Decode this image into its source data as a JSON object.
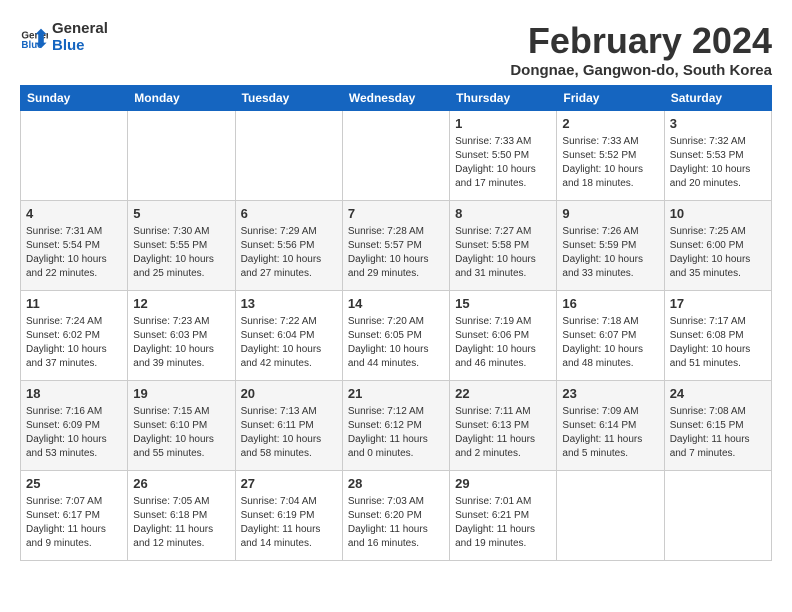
{
  "logo": {
    "line1": "General",
    "line2": "Blue"
  },
  "title": "February 2024",
  "location": "Dongnae, Gangwon-do, South Korea",
  "days_of_week": [
    "Sunday",
    "Monday",
    "Tuesday",
    "Wednesday",
    "Thursday",
    "Friday",
    "Saturday"
  ],
  "weeks": [
    [
      {
        "day": "",
        "content": ""
      },
      {
        "day": "",
        "content": ""
      },
      {
        "day": "",
        "content": ""
      },
      {
        "day": "",
        "content": ""
      },
      {
        "day": "1",
        "content": "Sunrise: 7:33 AM\nSunset: 5:50 PM\nDaylight: 10 hours and 17 minutes."
      },
      {
        "day": "2",
        "content": "Sunrise: 7:33 AM\nSunset: 5:52 PM\nDaylight: 10 hours and 18 minutes."
      },
      {
        "day": "3",
        "content": "Sunrise: 7:32 AM\nSunset: 5:53 PM\nDaylight: 10 hours and 20 minutes."
      }
    ],
    [
      {
        "day": "4",
        "content": "Sunrise: 7:31 AM\nSunset: 5:54 PM\nDaylight: 10 hours and 22 minutes."
      },
      {
        "day": "5",
        "content": "Sunrise: 7:30 AM\nSunset: 5:55 PM\nDaylight: 10 hours and 25 minutes."
      },
      {
        "day": "6",
        "content": "Sunrise: 7:29 AM\nSunset: 5:56 PM\nDaylight: 10 hours and 27 minutes."
      },
      {
        "day": "7",
        "content": "Sunrise: 7:28 AM\nSunset: 5:57 PM\nDaylight: 10 hours and 29 minutes."
      },
      {
        "day": "8",
        "content": "Sunrise: 7:27 AM\nSunset: 5:58 PM\nDaylight: 10 hours and 31 minutes."
      },
      {
        "day": "9",
        "content": "Sunrise: 7:26 AM\nSunset: 5:59 PM\nDaylight: 10 hours and 33 minutes."
      },
      {
        "day": "10",
        "content": "Sunrise: 7:25 AM\nSunset: 6:00 PM\nDaylight: 10 hours and 35 minutes."
      }
    ],
    [
      {
        "day": "11",
        "content": "Sunrise: 7:24 AM\nSunset: 6:02 PM\nDaylight: 10 hours and 37 minutes."
      },
      {
        "day": "12",
        "content": "Sunrise: 7:23 AM\nSunset: 6:03 PM\nDaylight: 10 hours and 39 minutes."
      },
      {
        "day": "13",
        "content": "Sunrise: 7:22 AM\nSunset: 6:04 PM\nDaylight: 10 hours and 42 minutes."
      },
      {
        "day": "14",
        "content": "Sunrise: 7:20 AM\nSunset: 6:05 PM\nDaylight: 10 hours and 44 minutes."
      },
      {
        "day": "15",
        "content": "Sunrise: 7:19 AM\nSunset: 6:06 PM\nDaylight: 10 hours and 46 minutes."
      },
      {
        "day": "16",
        "content": "Sunrise: 7:18 AM\nSunset: 6:07 PM\nDaylight: 10 hours and 48 minutes."
      },
      {
        "day": "17",
        "content": "Sunrise: 7:17 AM\nSunset: 6:08 PM\nDaylight: 10 hours and 51 minutes."
      }
    ],
    [
      {
        "day": "18",
        "content": "Sunrise: 7:16 AM\nSunset: 6:09 PM\nDaylight: 10 hours and 53 minutes."
      },
      {
        "day": "19",
        "content": "Sunrise: 7:15 AM\nSunset: 6:10 PM\nDaylight: 10 hours and 55 minutes."
      },
      {
        "day": "20",
        "content": "Sunrise: 7:13 AM\nSunset: 6:11 PM\nDaylight: 10 hours and 58 minutes."
      },
      {
        "day": "21",
        "content": "Sunrise: 7:12 AM\nSunset: 6:12 PM\nDaylight: 11 hours and 0 minutes."
      },
      {
        "day": "22",
        "content": "Sunrise: 7:11 AM\nSunset: 6:13 PM\nDaylight: 11 hours and 2 minutes."
      },
      {
        "day": "23",
        "content": "Sunrise: 7:09 AM\nSunset: 6:14 PM\nDaylight: 11 hours and 5 minutes."
      },
      {
        "day": "24",
        "content": "Sunrise: 7:08 AM\nSunset: 6:15 PM\nDaylight: 11 hours and 7 minutes."
      }
    ],
    [
      {
        "day": "25",
        "content": "Sunrise: 7:07 AM\nSunset: 6:17 PM\nDaylight: 11 hours and 9 minutes."
      },
      {
        "day": "26",
        "content": "Sunrise: 7:05 AM\nSunset: 6:18 PM\nDaylight: 11 hours and 12 minutes."
      },
      {
        "day": "27",
        "content": "Sunrise: 7:04 AM\nSunset: 6:19 PM\nDaylight: 11 hours and 14 minutes."
      },
      {
        "day": "28",
        "content": "Sunrise: 7:03 AM\nSunset: 6:20 PM\nDaylight: 11 hours and 16 minutes."
      },
      {
        "day": "29",
        "content": "Sunrise: 7:01 AM\nSunset: 6:21 PM\nDaylight: 11 hours and 19 minutes."
      },
      {
        "day": "",
        "content": ""
      },
      {
        "day": "",
        "content": ""
      }
    ]
  ]
}
